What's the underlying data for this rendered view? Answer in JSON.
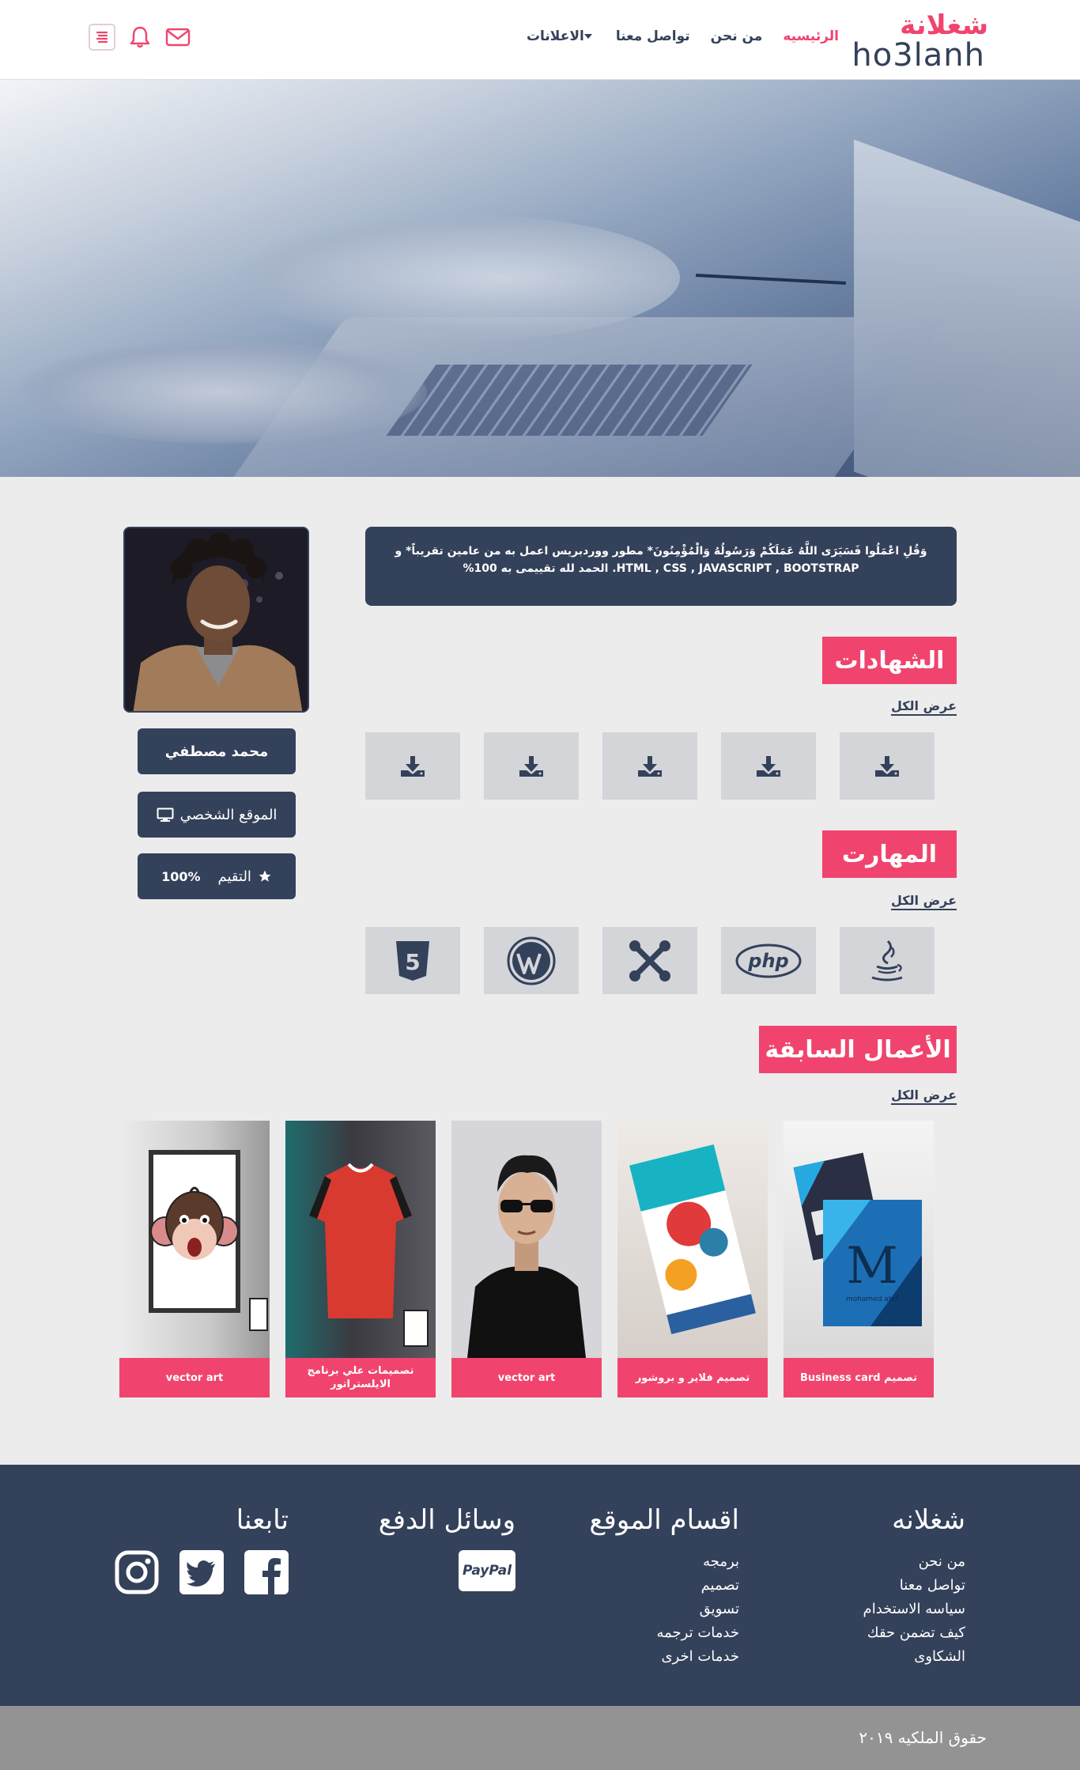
{
  "header": {
    "logo_ar": "شغلانة",
    "logo_en": "ho3lanh",
    "nav": [
      {
        "label": "الرئيسيه",
        "active": true
      },
      {
        "label": "من نحن",
        "active": false
      },
      {
        "label": "تواصل معنا",
        "active": false
      },
      {
        "label": "الاعلانات",
        "active": false,
        "dropdown": true
      }
    ],
    "icons": [
      "mail-icon",
      "bell-icon",
      "menu-icon"
    ]
  },
  "profile": {
    "name": "محمد مصطفي",
    "website_label": "الموقع الشخصي",
    "rating_label": "التقيم",
    "rating_value": "100%",
    "bio": "وَقُلِ اعْمَلُوا فَسَيَرَى اللَّهُ عَمَلَكُمْ وَرَسُولُهُ وَالْمُؤْمِنُونَ* مطور ووردبريس اعمل به من عامين تقريباً* و HTML , CSS , JAVASCRIPT , BOOTSTRAP. الحمد لله تقييمى به 100%"
  },
  "certificates": {
    "title": "الشهادات",
    "view_all": "عرض الكل",
    "count": 5
  },
  "skills": {
    "title": "المهارت",
    "view_all": "عرض الكل",
    "items": [
      "java-icon",
      "php-icon",
      "joomla-icon",
      "wordpress-icon",
      "html5-icon"
    ],
    "php_text": "php",
    "html_text": "5"
  },
  "works": {
    "title": "الأعمال السابقة",
    "view_all": "عرض الكل",
    "items": [
      {
        "caption": "تصميم  Business card"
      },
      {
        "caption": "تصميم فلاير و بروشور"
      },
      {
        "caption": "vector art"
      },
      {
        "caption": "تصميمات علي برنامج الايلستراتور"
      },
      {
        "caption": "vector art"
      }
    ],
    "card_letter": "M",
    "card_name": "mohamed atef"
  },
  "footer": {
    "col1": {
      "title": "شغلانه",
      "links": [
        "من نحن",
        "تواصل معنا",
        "سياسه الاستخدام",
        "كيف تضمن حقك",
        "الشكاوى"
      ]
    },
    "col2": {
      "title": "اقسام الموقع",
      "links": [
        "برمجه",
        "تصميم",
        "تسويق",
        "خدمات ترجمه",
        "خدمات اخرى"
      ]
    },
    "col3": {
      "title": "وسائل الدفع",
      "paypal": "PayPal"
    },
    "col4": {
      "title": "تابعنا",
      "social": [
        "facebook-icon",
        "twitter-icon",
        "instagram-icon"
      ]
    },
    "copyright": "حقوق الملكيه ٢٠١٩"
  },
  "colors": {
    "accent": "#f0446e",
    "navy": "#34415a",
    "bg": "#ececec"
  }
}
